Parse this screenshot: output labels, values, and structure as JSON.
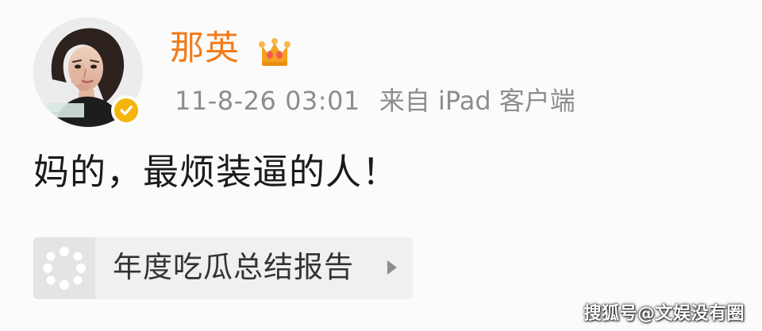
{
  "post": {
    "username": "那英",
    "time": "11-8-26 03:01",
    "source": "来自 iPad 客户端",
    "text": "妈的，最烦装逼的人！"
  },
  "report_card": {
    "label": "年度吃瓜总结报告"
  },
  "watermark": {
    "text": "搜狐号@文娱没有圈"
  },
  "colors": {
    "username": "#f47b19",
    "meta_text": "#8d8d8d",
    "body_text": "#1a1a1a",
    "verified_badge": "#f5b50c",
    "crown": "#f3a11f"
  },
  "icons": {
    "avatar": "avatar",
    "verified": "verified-icon",
    "crown": "crown-icon",
    "report": "report-icon",
    "chevron": "chevron-right-icon"
  }
}
